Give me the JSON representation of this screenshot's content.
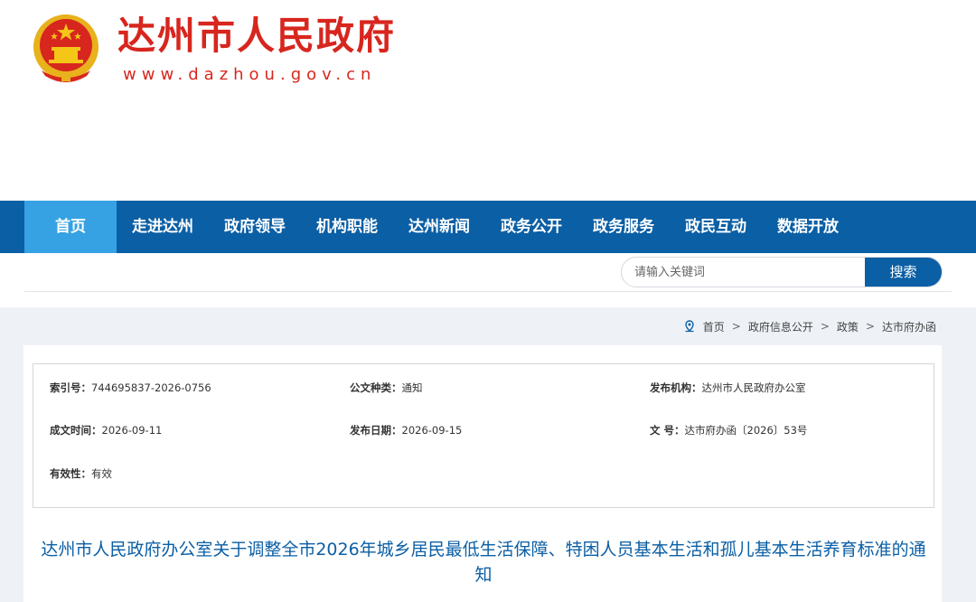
{
  "site": {
    "title": "达州市人民政府",
    "url": "www.dazhou.gov.cn",
    "emblem_icon": "national-emblem-icon"
  },
  "nav": {
    "items": [
      {
        "label": "首页",
        "active": true
      },
      {
        "label": "走进达州"
      },
      {
        "label": "政府领导"
      },
      {
        "label": "机构职能"
      },
      {
        "label": "达州新闻"
      },
      {
        "label": "政务公开"
      },
      {
        "label": "政务服务"
      },
      {
        "label": "政民互动"
      },
      {
        "label": "数据开放"
      }
    ]
  },
  "search": {
    "placeholder": "请输入关键词",
    "button_label": "搜索"
  },
  "breadcrumb": {
    "icon": "location-pin-icon",
    "items": [
      "首页",
      "政府信息公开",
      "政策",
      "达市府办函"
    ],
    "separator": ">"
  },
  "meta": {
    "index_no_label": "索引号：",
    "index_no": "744695837-2026-0756",
    "doc_type_label": "公文种类：",
    "doc_type": "通知",
    "issuer_label": "发布机构：",
    "issuer": "达州市人民政府办公室",
    "created_label": "成文时间：",
    "created": "2026-09-11",
    "published_label": "发布日期：",
    "published": "2026-09-15",
    "doc_no_label": "文 号：",
    "doc_no": "达市府办函〔2026〕53号",
    "validity_label": "有效性：",
    "validity": "有效"
  },
  "document": {
    "title": "达州市人民政府办公室关于调整全市2026年城乡居民最低生活保障、特困人员基本生活和孤儿基本生活养育标准的通知"
  },
  "colors": {
    "brand_red": "#d7261e",
    "nav_blue": "#0b5fa5",
    "nav_active": "#36a2e3",
    "title_blue": "#0b5fa5"
  }
}
